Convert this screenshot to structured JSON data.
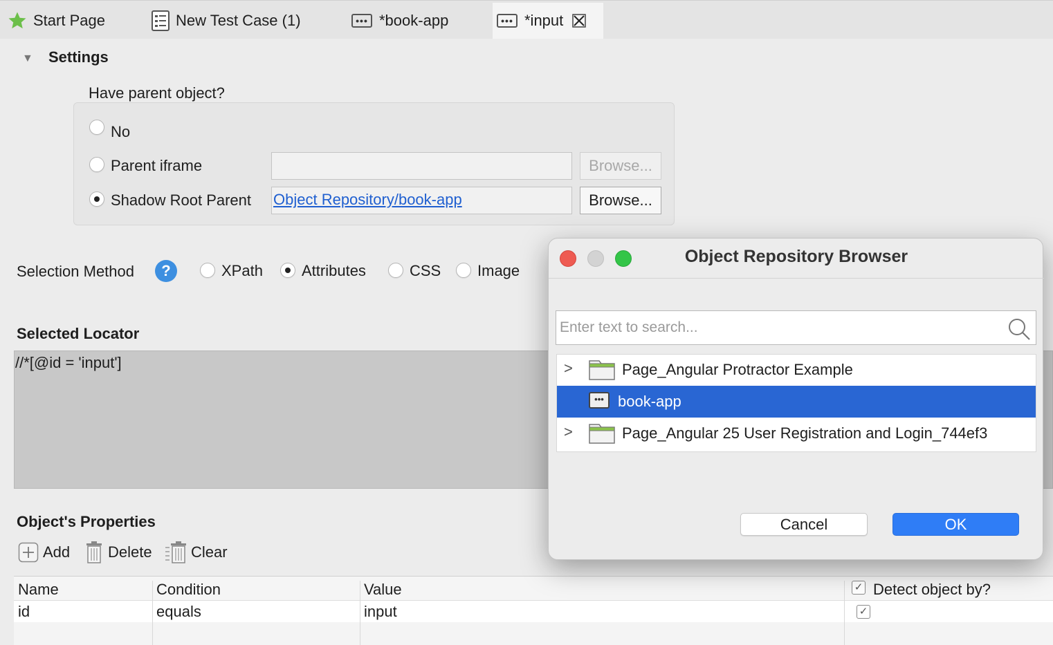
{
  "tabs": [
    {
      "label": "Start Page",
      "icon": "star-icon"
    },
    {
      "label": "New Test Case (1)",
      "icon": "test-case-icon"
    },
    {
      "label": "*book-app",
      "icon": "web-object-icon"
    },
    {
      "label": "*input",
      "icon": "web-object-icon",
      "close_icon": "close-icon"
    }
  ],
  "settings": {
    "header": "Settings",
    "parent_question": "Have parent object?",
    "options": {
      "no": "No",
      "parent_iframe": "Parent iframe",
      "shadow_root": "Shadow Root Parent"
    },
    "iframe_value": "",
    "shadow_root_value": "Object Repository/book-app",
    "browse_label": "Browse...",
    "selected_option": "Shadow Root Parent"
  },
  "selection": {
    "label": "Selection Method",
    "help": "?",
    "methods": [
      "XPath",
      "Attributes",
      "CSS",
      "Image"
    ],
    "selected": "Attributes"
  },
  "locator": {
    "header": "Selected Locator",
    "value": "//*[@id = 'input']"
  },
  "properties": {
    "header": "Object's Properties",
    "toolbar": {
      "add": "Add",
      "delete": "Delete",
      "clear": "Clear"
    },
    "columns": [
      "Name",
      "Condition",
      "Value",
      "Detect object by?"
    ],
    "rows": [
      {
        "name": "id",
        "condition": "equals",
        "value": "input",
        "detect": true
      }
    ]
  },
  "dialog": {
    "title": "Object Repository Browser",
    "search_placeholder": "Enter text to search...",
    "items": [
      {
        "label": "Page_Angular Protractor Example",
        "type": "folder",
        "expandable": true,
        "selected": false
      },
      {
        "label": "book-app",
        "type": "object",
        "expandable": false,
        "selected": true
      },
      {
        "label": "Page_Angular 25 User Registration and Login_744ef3",
        "type": "folder",
        "expandable": true,
        "selected": false
      }
    ],
    "cancel": "Cancel",
    "ok": "OK"
  },
  "colors": {
    "selection": "#2966d3",
    "ok_button": "#2f7df6",
    "link": "#1f5fd0",
    "folder_green": "#8bc34a",
    "star_green": "#6cbf4a"
  }
}
